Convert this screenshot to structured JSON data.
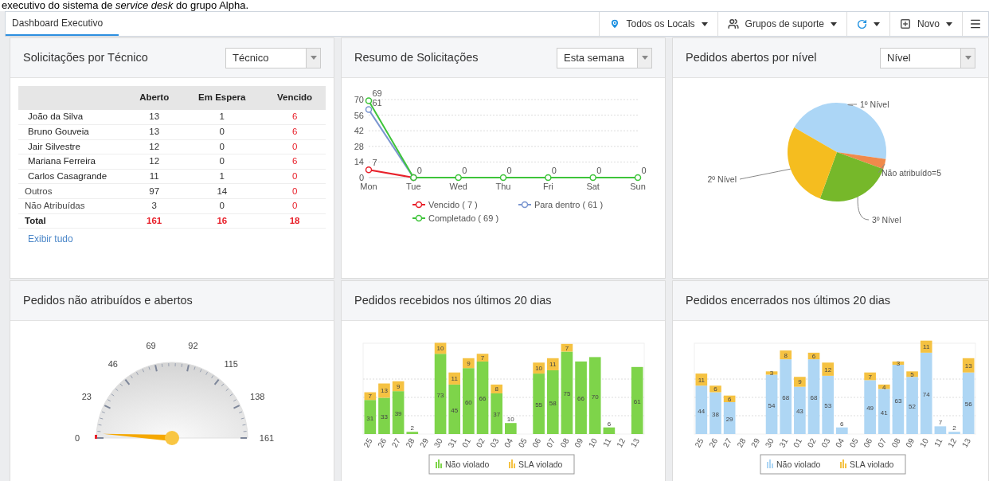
{
  "caption": "executivo do sistema de *service desk* do grupo Alpha.",
  "tabs": [
    {
      "label": "Dashboard Executivo",
      "selected": true
    }
  ],
  "toolbar": [
    {
      "kind": "location",
      "label": "Todos os Locals"
    },
    {
      "kind": "groups",
      "label": "Grupos de suporte"
    },
    {
      "kind": "refresh"
    },
    {
      "kind": "new",
      "label": "Novo"
    },
    {
      "kind": "menu"
    }
  ],
  "panels": [
    {
      "kind": "table",
      "title": "Solicitações por Técnico",
      "select": "Técnico",
      "columns": [
        "Aberto",
        "Em Espera",
        "Vencido"
      ],
      "rows": [
        {
          "kind": "technician",
          "name": "João da Silva",
          "cells": [
            "13",
            "1",
            "6"
          ]
        },
        {
          "kind": "technician",
          "name": "Bruno Gouveia",
          "cells": [
            "13",
            "0",
            "6"
          ]
        },
        {
          "kind": "technician",
          "name": "Jair Silvestre",
          "cells": [
            "12",
            "0",
            "0"
          ]
        },
        {
          "kind": "technician",
          "name": "Mariana Ferreira",
          "cells": [
            "12",
            "0",
            "6"
          ]
        },
        {
          "kind": "technician",
          "name": "Carlos Casagrande",
          "cells": [
            "11",
            "1",
            "0"
          ]
        },
        {
          "kind": "group",
          "name": "Outros",
          "cells": [
            "97",
            "14",
            "0"
          ]
        },
        {
          "kind": "group",
          "name": "Não Atribuídas",
          "cells": [
            "3",
            "0",
            "0"
          ]
        },
        {
          "kind": "total",
          "name": "Total",
          "cells": [
            "161",
            "16",
            "18"
          ]
        }
      ],
      "link": "Exibir tudo"
    },
    {
      "kind": "line",
      "title": "Resumo de Solicitações",
      "select": "Esta semana",
      "chart_data": {
        "type": "line",
        "categories": [
          "Mon",
          "Tue",
          "Wed",
          "Thu",
          "Fri",
          "Sat",
          "Sun"
        ],
        "ylim": [
          0,
          70
        ],
        "yticks": [
          0,
          14,
          28,
          42,
          56,
          70
        ],
        "grid": true,
        "legend": "bottom",
        "series": [
          {
            "name": "Vencido ( 7 )",
            "color": "#e8202a",
            "marker": "circle",
            "values": [
              7,
              0,
              null,
              null,
              null,
              null,
              null
            ],
            "value_labels": [
              "7",
              null,
              null,
              null,
              null,
              null,
              null
            ]
          },
          {
            "name": "Para dentro ( 61 )",
            "color": "#7b96d0",
            "marker": "circle",
            "values": [
              61,
              0,
              null,
              null,
              null,
              null,
              null
            ],
            "value_labels": [
              "61",
              null,
              null,
              null,
              null,
              null,
              null
            ]
          },
          {
            "name": "Completado ( 69 )",
            "color": "#3ec43a",
            "marker": "circle",
            "values": [
              69,
              0,
              0,
              0,
              0,
              0,
              0
            ],
            "value_labels": [
              "69",
              "0",
              "0",
              "0",
              "0",
              "0",
              "0"
            ]
          }
        ]
      }
    },
    {
      "kind": "pie",
      "title": "Pedidos abertos por nível",
      "select": "Nível",
      "slices": [
        {
          "label": "1º Nível",
          "color": "#acd6f6"
        },
        {
          "label": "Não atribuído=5",
          "color": "#f08a4b"
        },
        {
          "label": "3º Nível",
          "color": "#76b82a"
        },
        {
          "label": "2º Nível",
          "color": "#f5bd1f"
        }
      ]
    },
    {
      "kind": "gauge",
      "title": "Pedidos não atribuídos e abertos",
      "ticks": [
        "0",
        "23",
        "46",
        "69",
        "92",
        "115",
        "138",
        "161"
      ]
    },
    {
      "kind": "bar",
      "title": "Pedidos recebidos nos últimos 20 dias",
      "chart_data": {
        "type": "bar",
        "stacked": true,
        "legend": "bottom",
        "categories": [
          "25",
          "26",
          "27",
          "28",
          "29",
          "30",
          "31",
          "01",
          "02",
          "03",
          "04",
          "05",
          "06",
          "07",
          "08",
          "09",
          "10",
          "11",
          "12",
          "13"
        ],
        "series": [
          {
            "name": "Não violado",
            "color": "#7ed44a",
            "values": [
              31,
              33,
              39,
              2,
              0,
              73,
              45,
              60,
              66,
              37,
              10,
              0,
              55,
              58,
              75,
              66,
              70,
              6,
              0,
              61
            ],
            "value_labels": [
              "31",
              "33",
              "39",
              "2",
              null,
              "73",
              "45",
              "60",
              "66",
              "37",
              "10",
              null,
              "55",
              "58",
              "75",
              "66",
              "70",
              "6",
              null,
              "61"
            ]
          },
          {
            "name": "SLA violado",
            "color": "#f5c242",
            "values": [
              7,
              13,
              9,
              0,
              0,
              10,
              11,
              9,
              7,
              8,
              0,
              0,
              10,
              11,
              7,
              0,
              0,
              0,
              0,
              0
            ],
            "value_labels": [
              "7",
              "13",
              "9",
              null,
              null,
              "10",
              "11",
              "9",
              "7",
              "8",
              null,
              null,
              "10",
              "11",
              "7",
              null,
              null,
              null,
              null,
              null
            ]
          }
        ]
      }
    },
    {
      "kind": "bar",
      "title": "Pedidos encerrados nos últimos 20 dias",
      "chart_data": {
        "type": "bar",
        "stacked": true,
        "legend": "bottom",
        "categories": [
          "25",
          "26",
          "27",
          "28",
          "29",
          "30",
          "31",
          "01",
          "02",
          "03",
          "04",
          "05",
          "06",
          "07",
          "08",
          "09",
          "10",
          "11",
          "12",
          "13"
        ],
        "series": [
          {
            "name": "Não violado",
            "color": "#aed6f4",
            "values": [
              44,
              38,
              29,
              0,
              0,
              54,
              68,
              43,
              68,
              53,
              6,
              0,
              49,
              41,
              63,
              52,
              74,
              7,
              2,
              56
            ],
            "value_labels": [
              "44",
              "38",
              "29",
              null,
              null,
              "54",
              "68",
              "43",
              "68",
              "53",
              "6",
              null,
              "49",
              "41",
              "63",
              "52",
              "74",
              "7",
              "2",
              "56"
            ]
          },
          {
            "name": "SLA violado",
            "color": "#f5c242",
            "values": [
              11,
              6,
              6,
              0,
              0,
              3,
              8,
              9,
              6,
              12,
              0,
              0,
              7,
              4,
              3,
              5,
              11,
              0,
              0,
              13
            ],
            "value_labels": [
              "11",
              "6",
              "6",
              null,
              null,
              "3",
              "8",
              "9",
              "6",
              "12",
              null,
              null,
              "7",
              "4",
              "3",
              "5",
              "11",
              null,
              null,
              "13"
            ]
          }
        ]
      }
    }
  ]
}
